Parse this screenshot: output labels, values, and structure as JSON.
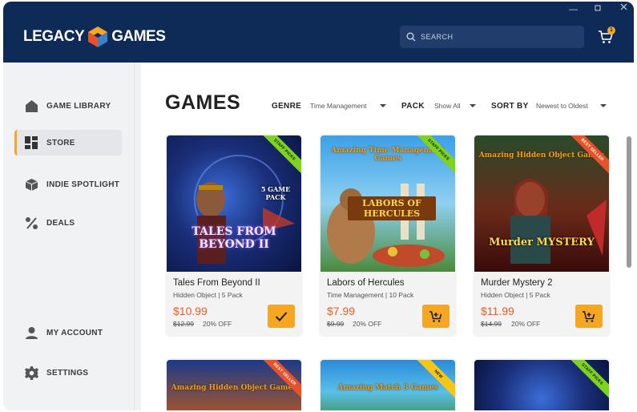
{
  "header": {
    "logo_text_left": "LEGACY",
    "logo_text_right": "GAMES",
    "search_placeholder": "SEARCH",
    "cart_count": "1"
  },
  "sidebar": {
    "items": [
      {
        "label": "GAME LIBRARY"
      },
      {
        "label": "STORE"
      },
      {
        "label": "INDIE SPOTLIGHT"
      },
      {
        "label": "DEALS"
      },
      {
        "label": "MY ACCOUNT"
      },
      {
        "label": "SETTINGS"
      }
    ]
  },
  "main": {
    "title": "GAMES",
    "filters": {
      "genre_label": "GENRE",
      "genre_value": "Time Management",
      "pack_label": "PACK",
      "pack_value": "Show All",
      "sort_label": "SORT BY",
      "sort_value": "Newest to Oldest"
    },
    "cards": [
      {
        "name": "Tales From Beyond II",
        "meta": "Hidden Object | 5 Pack",
        "price": "$10.99",
        "old_price": "$12.99",
        "discount": "20% OFF",
        "ribbon": "STAFF PICKS",
        "art_title": "TALES FROM BEYOND II",
        "art_sub": "5 GAME PACK"
      },
      {
        "name": "Labors of Hercules",
        "meta": "Time Management | 10 Pack",
        "price": "$7.99",
        "old_price": "$9.99",
        "discount": "20% OFF",
        "ribbon": "STAFF PICKS",
        "art_title": "LABORS OF HERCULES",
        "art_sub": "Amazing Time Management Games"
      },
      {
        "name": "Murder Mystery 2",
        "meta": "Hidden Object | 5 Pack",
        "price": "$11.99",
        "old_price": "$14.99",
        "discount": "20% OFF",
        "ribbon": "BEST SELLER",
        "art_title": "Murder MYSTERY",
        "art_sub": "Amazing Hidden Object Games"
      },
      {
        "ribbon": "BEST SELLER",
        "art_sub": "Amazing Hidden Object Games"
      },
      {
        "ribbon": "NEW",
        "art_sub": "Amazing Match 3 Games"
      },
      {
        "ribbon": "STAFF PICKS"
      }
    ]
  },
  "colors": {
    "header_bg": "#0e2a57",
    "accent": "#f5a623",
    "price": "#e85d1c",
    "ribbon_staff": "#7ed321",
    "ribbon_best": "#e8512a",
    "ribbon_new": "#f5c518"
  },
  "icons": {
    "library": "home-icon",
    "store": "grid-icon",
    "indie": "box-icon",
    "deals": "percent-icon",
    "account": "user-icon",
    "settings": "gear-icon",
    "search": "search-icon",
    "cart": "cart-icon",
    "owned": "check-icon",
    "add": "add-to-cart-icon"
  }
}
